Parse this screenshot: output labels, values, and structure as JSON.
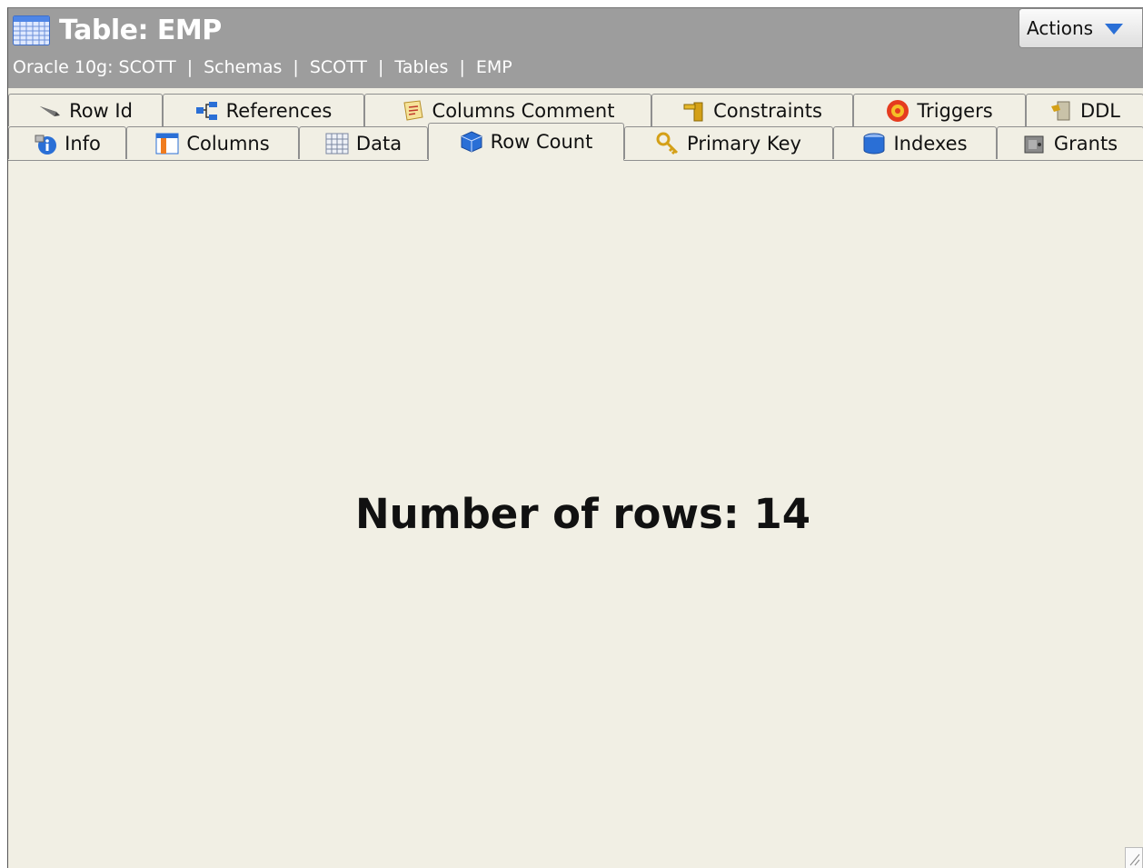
{
  "header": {
    "title": "Table: EMP",
    "breadcrumb": [
      "Oracle 10g: SCOTT",
      "Schemas",
      "SCOTT",
      "Tables",
      "EMP"
    ],
    "breadcrumb_separator": "|",
    "actions_label": "Actions"
  },
  "tabs": {
    "back_row": [
      {
        "label": "Row Id",
        "icon": "pen-icon"
      },
      {
        "label": "References",
        "icon": "references-icon"
      },
      {
        "label": "Columns Comment",
        "icon": "comment-icon"
      },
      {
        "label": "Constraints",
        "icon": "constraints-icon"
      },
      {
        "label": "Triggers",
        "icon": "triggers-icon"
      },
      {
        "label": "DDL",
        "icon": "ddl-icon"
      }
    ],
    "front_row": [
      {
        "label": "Info",
        "icon": "info-icon"
      },
      {
        "label": "Columns",
        "icon": "columns-icon"
      },
      {
        "label": "Data",
        "icon": "data-grid-icon"
      },
      {
        "label": "Row Count",
        "icon": "row-count-icon",
        "active": true
      },
      {
        "label": "Primary Key",
        "icon": "key-icon"
      },
      {
        "label": "Indexes",
        "icon": "indexes-icon"
      },
      {
        "label": "Grants",
        "icon": "grants-icon"
      }
    ]
  },
  "content": {
    "row_count_text": "Number of rows: 14"
  },
  "colors": {
    "header_bg": "#9d9d9d",
    "panel_bg": "#f1efe4",
    "accent_blue": "#2a6fd6"
  }
}
